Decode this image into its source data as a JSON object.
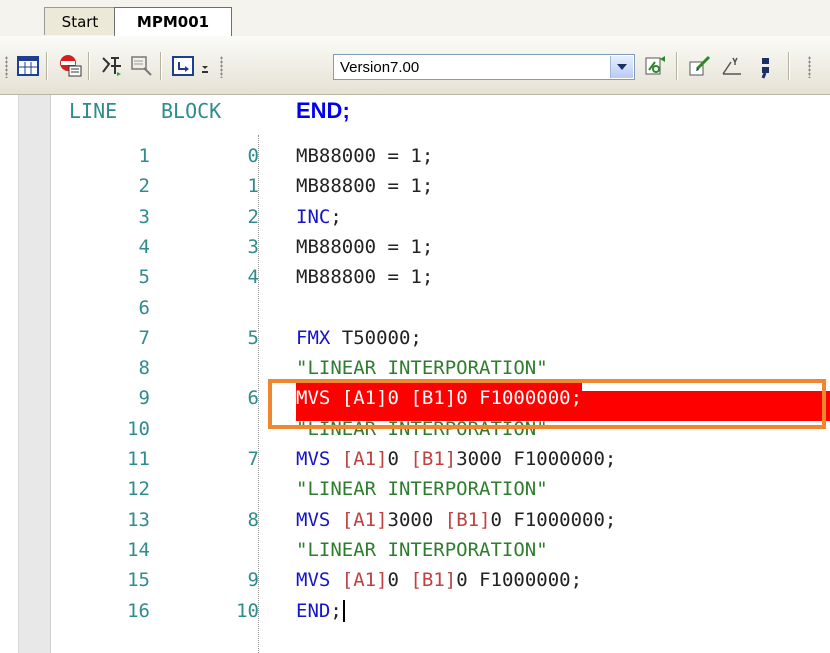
{
  "tabs": [
    {
      "label": "Start",
      "active": false
    },
    {
      "label": "MPM001",
      "active": true
    }
  ],
  "toolbar": {
    "version_combo": {
      "value": "Version7.00"
    },
    "icons": [
      "table-view-icon",
      "stop-sign-icon",
      "branch-icon",
      "search-select-icon",
      "return-arrow-icon",
      "go-icon",
      "edit-pencil-icon",
      "axis-icon",
      "semicolon-icon"
    ]
  },
  "editor": {
    "header": {
      "line": "LINE",
      "block": "BLOCK",
      "first_code": "END;"
    },
    "rows": [
      {
        "line": "1",
        "block": "0",
        "code": "MB88000 = 1;"
      },
      {
        "line": "2",
        "block": "1",
        "code": "MB88800 = 1;"
      },
      {
        "line": "3",
        "block": "2",
        "code": "INC;"
      },
      {
        "line": "4",
        "block": "3",
        "code": "MB88000 = 1;"
      },
      {
        "line": "5",
        "block": "4",
        "code": "MB88800 = 1;"
      },
      {
        "line": "6",
        "block": "",
        "code": ""
      },
      {
        "line": "7",
        "block": "5",
        "code": "FMX T50000;"
      },
      {
        "line": "8",
        "block": "",
        "code": "\"LINEAR INTERPORATION\""
      },
      {
        "line": "9",
        "block": "6",
        "code": "MVS [A1]0 [B1]0 F1000000;"
      },
      {
        "line": "10",
        "block": "",
        "code": "\"LINEAR INTERPORATION\""
      },
      {
        "line": "11",
        "block": "7",
        "code": "MVS [A1]0 [B1]3000 F1000000;"
      },
      {
        "line": "12",
        "block": "",
        "code": "\"LINEAR INTERPORATION\""
      },
      {
        "line": "13",
        "block": "8",
        "code": "MVS [A1]3000 [B1]0 F1000000;"
      },
      {
        "line": "14",
        "block": "",
        "code": "\"LINEAR INTERPORATION\""
      },
      {
        "line": "15",
        "block": "9",
        "code": "MVS [A1]0 [B1]0 F1000000;"
      },
      {
        "line": "16",
        "block": "10",
        "code": "END;"
      }
    ],
    "highlighted_line": "9"
  },
  "colors": {
    "highlight": "#ff0000",
    "frame": "#f0862e",
    "line_numbers": "#2f8c8c",
    "keyword": "#1414c8",
    "axis": "#c04040",
    "comment": "#2e7d2e"
  }
}
